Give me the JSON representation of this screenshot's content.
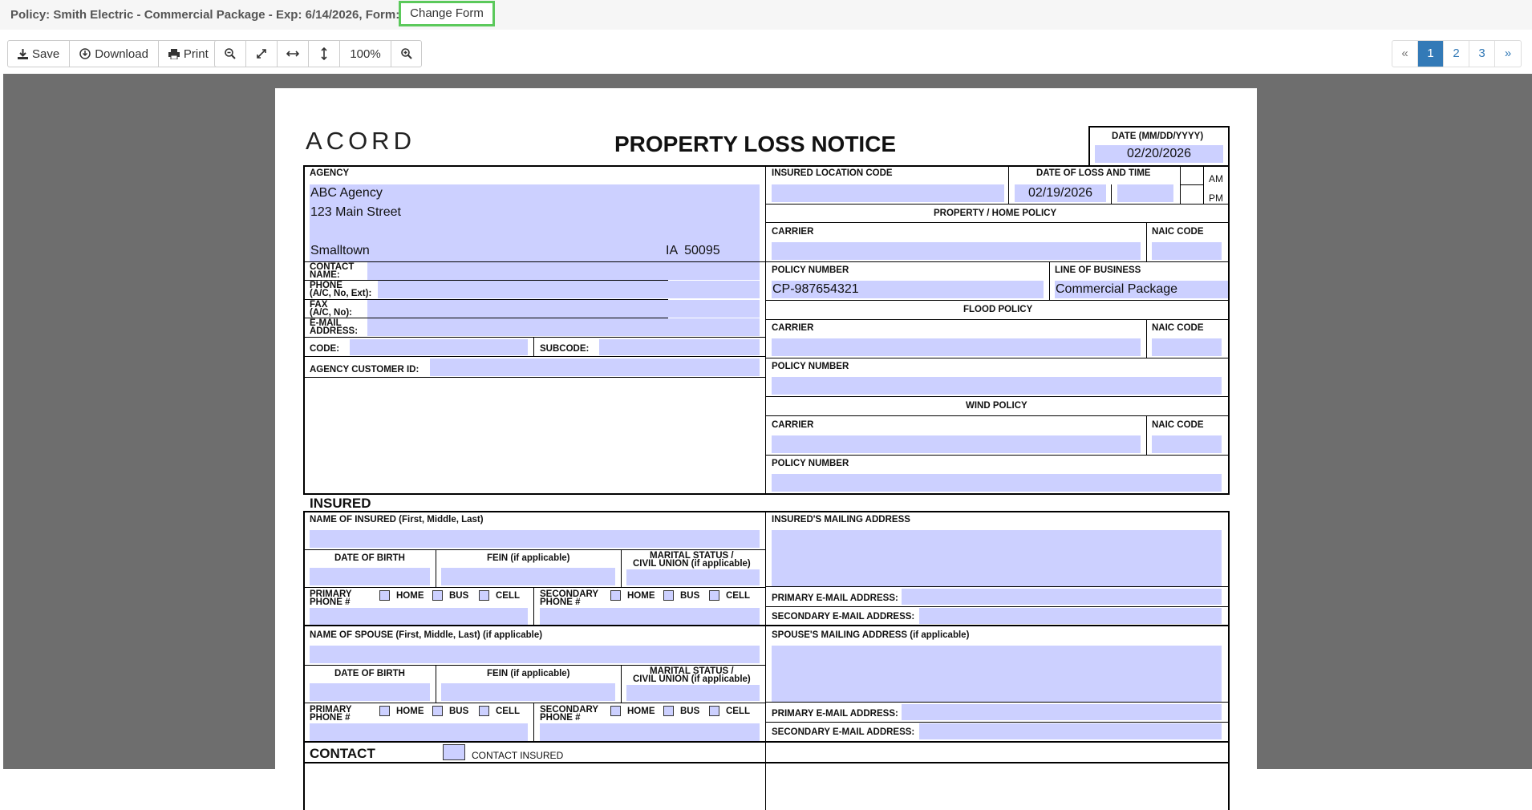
{
  "topbar": {
    "policy_title": "Policy: Smith Electric - Commercial Package - Exp: 6/14/2026, Form: 1",
    "change_form_label": "Change Form"
  },
  "toolbar": {
    "save_label": "Save",
    "download_label": "Download",
    "print_label": "Print",
    "zoom_level": "100%",
    "icons": [
      "save-icon",
      "download-icon",
      "print-icon",
      "zoom-out-icon",
      "fit-page-icon",
      "fit-width-icon",
      "fit-height-icon",
      "zoom-in-icon"
    ]
  },
  "pager": {
    "prev": "«",
    "pages": [
      "1",
      "2",
      "3"
    ],
    "active": "1",
    "next": "»"
  },
  "form": {
    "logo": "ACORD",
    "title": "PROPERTY LOSS NOTICE",
    "date_label": "DATE (MM/DD/YYYY)",
    "date_value": "02/20/2026",
    "agency": {
      "label": "AGENCY",
      "name": "ABC Agency",
      "street": "123 Main Street",
      "city": "Smalltown",
      "state_zip": "IA  50095",
      "contact_label_1": "CONTACT",
      "contact_label_2": "NAME:",
      "phone_label_1": "PHONE",
      "phone_label_2": "(A/C, No, Ext):",
      "fax_label_1": "FAX",
      "fax_label_2": "(A/C, No):",
      "email_label_1": "E-MAIL",
      "email_label_2": "ADDRESS:",
      "code_label": "CODE:",
      "subcode_label": "SUBCODE:",
      "customer_id_label": "AGENCY CUSTOMER ID:"
    },
    "loss": {
      "insured_location_code_label": "INSURED LOCATION CODE",
      "date_of_loss_label": "DATE OF LOSS AND TIME",
      "date_of_loss_value": "02/19/2026",
      "am": "AM",
      "pm": "PM"
    },
    "property_policy": {
      "header": "PROPERTY / HOME POLICY",
      "carrier_label": "CARRIER",
      "naic_label": "NAIC CODE",
      "policy_number_label": "POLICY NUMBER",
      "policy_number_value": "CP-987654321",
      "lob_label": "LINE OF BUSINESS",
      "lob_value": "Commercial Package"
    },
    "flood_policy": {
      "header": "FLOOD POLICY",
      "carrier_label": "CARRIER",
      "naic_label": "NAIC CODE",
      "policy_number_label": "POLICY NUMBER"
    },
    "wind_policy": {
      "header": "WIND POLICY",
      "carrier_label": "CARRIER",
      "naic_label": "NAIC CODE",
      "policy_number_label": "POLICY NUMBER"
    },
    "insured": {
      "section": "INSURED",
      "name_label": "NAME OF INSURED (First, Middle, Last)",
      "mailing_label": "INSURED'S MAILING ADDRESS",
      "dob_label": "DATE OF BIRTH",
      "fein_label": "FEIN (if applicable)",
      "marital_label_1": "MARITAL STATUS /",
      "marital_label_2": "CIVIL UNION (if applicable)",
      "primary_phone_1": "PRIMARY",
      "primary_phone_2": "PHONE #",
      "secondary_phone_1": "SECONDARY",
      "secondary_phone_2": "PHONE #",
      "home": "HOME",
      "bus": "BUS",
      "cell": "CELL",
      "primary_email_label": "PRIMARY E-MAIL ADDRESS:",
      "secondary_email_label": "SECONDARY E-MAIL ADDRESS:"
    },
    "spouse": {
      "name_label": "NAME OF SPOUSE (First, Middle, Last) (if applicable)",
      "mailing_label": "SPOUSE'S MAILING ADDRESS (if applicable)",
      "dob_label": "DATE OF BIRTH",
      "fein_label": "FEIN (if applicable)",
      "marital_label_1": "MARITAL STATUS /",
      "marital_label_2": "CIVIL UNION (if applicable)",
      "primary_phone_1": "PRIMARY",
      "primary_phone_2": "PHONE #",
      "secondary_phone_1": "SECONDARY",
      "secondary_phone_2": "PHONE #",
      "home": "HOME",
      "bus": "BUS",
      "cell": "CELL",
      "primary_email_label": "PRIMARY E-MAIL ADDRESS:",
      "secondary_email_label": "SECONDARY E-MAIL ADDRESS:"
    },
    "contact": {
      "section": "CONTACT",
      "contact_insured_label": "CONTACT INSURED"
    }
  }
}
